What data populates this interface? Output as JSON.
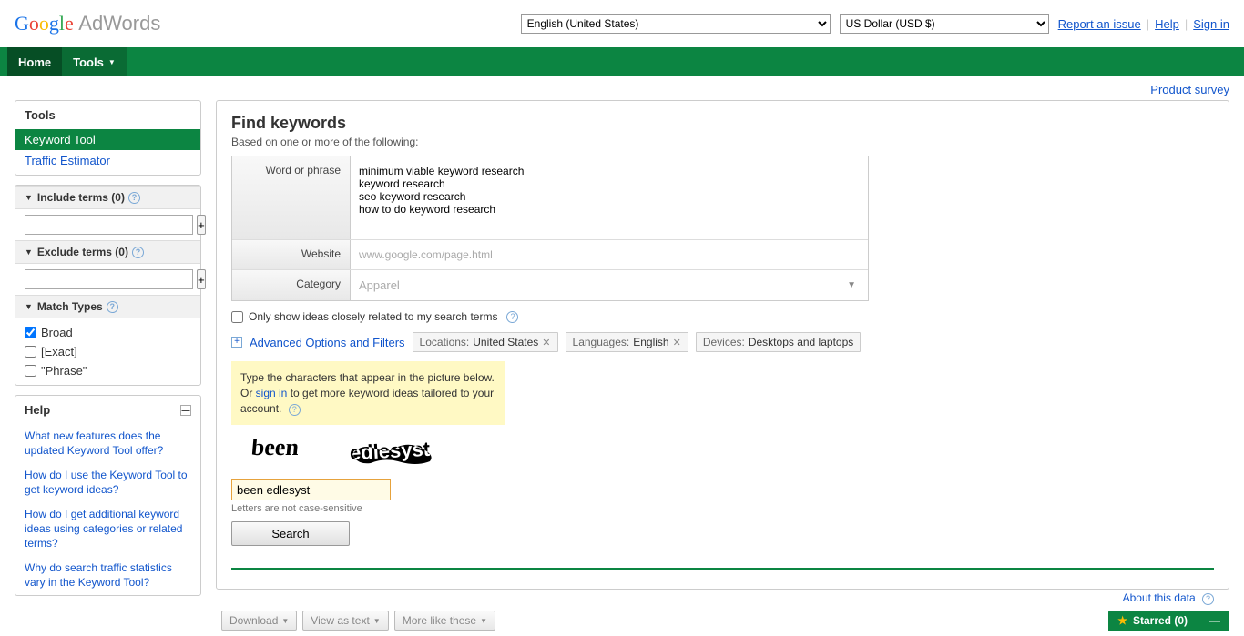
{
  "header": {
    "logo_product": "AdWords",
    "language_selected": "English (United States)",
    "currency_selected": "US Dollar (USD $)",
    "report_issue": "Report an issue",
    "help": "Help",
    "sign_in": "Sign in"
  },
  "nav": {
    "home": "Home",
    "tools": "Tools"
  },
  "sublink": {
    "product_survey": "Product survey"
  },
  "sidebar": {
    "tools_title": "Tools",
    "keyword_tool": "Keyword Tool",
    "traffic_estimator": "Traffic Estimator",
    "include_terms": "Include terms (0)",
    "exclude_terms": "Exclude terms (0)",
    "match_types": "Match Types",
    "match_broad": "Broad",
    "match_exact": "[Exact]",
    "match_phrase": "\"Phrase\"",
    "help_title": "Help",
    "help_links": [
      "What new features does the updated Keyword Tool offer?",
      "How do I use the Keyword Tool to get keyword ideas?",
      "How do I get additional keyword ideas using categories or related terms?",
      "Why do search traffic statistics vary in the Keyword Tool?"
    ]
  },
  "content": {
    "title": "Find keywords",
    "subtitle": "Based on one or more of the following:",
    "form": {
      "word_label": "Word or phrase",
      "word_value": "minimum viable keyword research\nkeyword research\nseo keyword research\nhow to do keyword research",
      "website_label": "Website",
      "website_placeholder": "www.google.com/page.html",
      "category_label": "Category",
      "category_placeholder": "Apparel"
    },
    "only_show": "Only show ideas closely related to my search terms",
    "advanced": "Advanced Options and Filters",
    "chips": {
      "locations_label": "Locations:",
      "locations_value": "United States",
      "languages_label": "Languages:",
      "languages_value": "English",
      "devices_label": "Devices:",
      "devices_value": "Desktops and laptops"
    },
    "captcha": {
      "line1": "Type the characters that appear in the picture below. Or ",
      "sign_in": "sign in",
      "line2": " to get more keyword ideas tailored to your account.",
      "input_value": "been edlesyst",
      "case_note": "Letters are not case-sensitive"
    },
    "search_btn": "Search",
    "about": "About this data"
  },
  "bottom": {
    "download": "Download",
    "view_as_text": "View as text",
    "more_like": "More like these",
    "starred": "Starred (0)"
  }
}
